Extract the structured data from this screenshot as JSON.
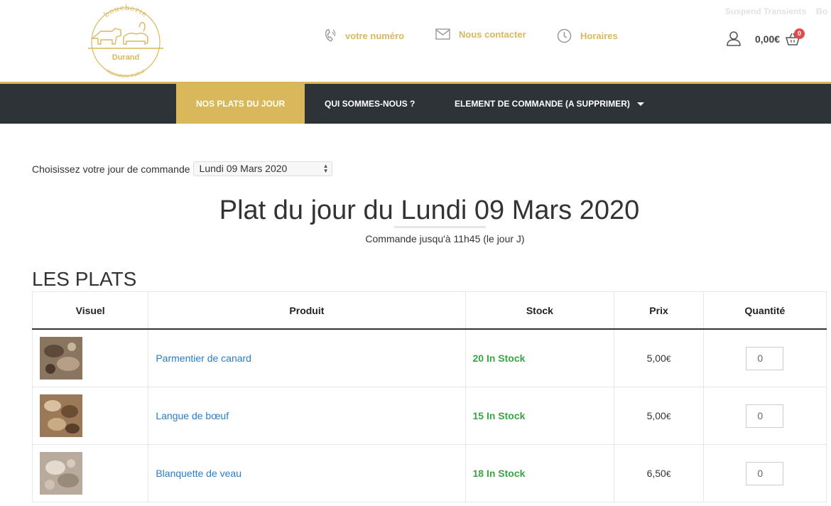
{
  "logo": {
    "top_text": "boucherie",
    "name": "Durand",
    "bottom_text": "charcuterie traiteur"
  },
  "admin_bar": {
    "item1": "Suspend Transients",
    "item2": "Bo"
  },
  "header": {
    "phone_label": "votre numéro",
    "contact_label": "Nous contacter",
    "hours_label": "Horaires",
    "cart_total": "0,00€",
    "cart_count": "0",
    "accent_color": "#d9b85c"
  },
  "nav": {
    "items": [
      {
        "label": "NOS PLATS DU JOUR"
      },
      {
        "label": "QUI SOMMES-NOUS ?"
      },
      {
        "label": "ELEMENT DE COMMANDE (A SUPPRIMER)"
      }
    ],
    "bg_color": "#2e3337"
  },
  "order": {
    "choose_label": "Choisissez votre jour de commande",
    "selected_day": "Lundi 09 Mars 2020"
  },
  "page": {
    "title": "Plat du jour du Lundi 09 Mars 2020",
    "subtitle": "Commande jusqu'à 11h45 (le jour J)",
    "section": "LES PLATS"
  },
  "table": {
    "headers": {
      "visuel": "Visuel",
      "produit": "Produit",
      "stock": "Stock",
      "prix": "Prix",
      "quantite": "Quantité"
    },
    "rows": [
      {
        "name": "Parmentier de canard",
        "stock": "20 In Stock",
        "price": "5,00",
        "currency": "€",
        "qty": "0"
      },
      {
        "name": "Langue de bœuf",
        "stock": "15 In Stock",
        "price": "5,00",
        "currency": "€",
        "qty": "0"
      },
      {
        "name": "Blanquette de veau",
        "stock": "18 In Stock",
        "price": "6,50",
        "currency": "€",
        "qty": "0"
      }
    ]
  }
}
